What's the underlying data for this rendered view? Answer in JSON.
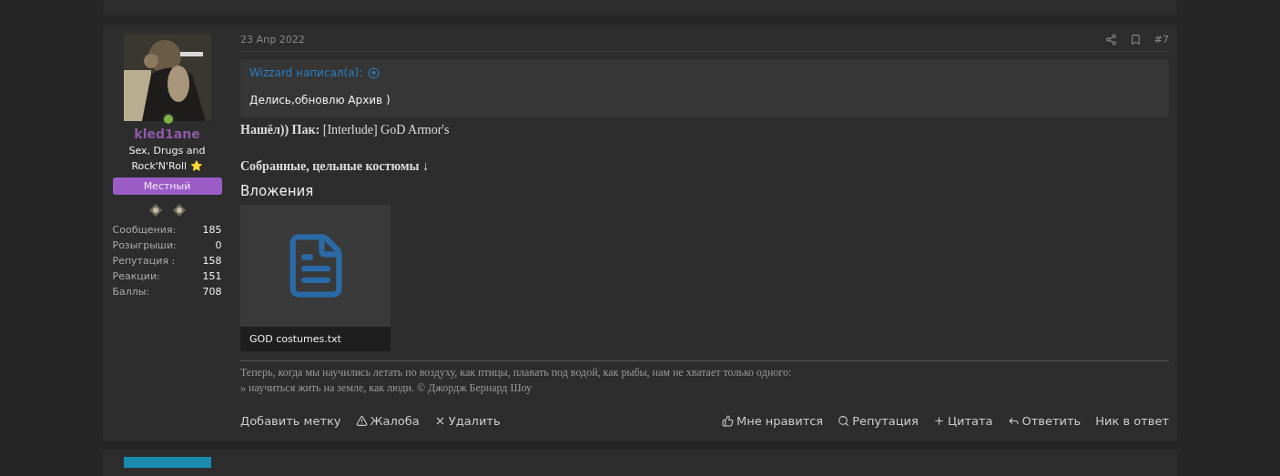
{
  "post": {
    "date": "23 Апр 2022",
    "number": "#7",
    "user": {
      "online": true,
      "name": "kled1ane",
      "title": "Sex, Drugs and Rock'N'Roll ⭐",
      "badge": "Местный",
      "stats": [
        {
          "label": "Сообщения:",
          "value": "185"
        },
        {
          "label": "Розыгрыши:",
          "value": "0"
        },
        {
          "label": "Репутация :",
          "value": "158"
        },
        {
          "label": "Реакции:",
          "value": "151"
        },
        {
          "label": "Баллы:",
          "value": "708"
        }
      ]
    },
    "quote": {
      "author": "Wizzard написал(а):",
      "text": "Делись,обновлю Архив )"
    },
    "body": [
      "**Нашёл)) Пак:** [Interlude] GoD Armor's",
      "**Собранные, цельные костюмы ↓**"
    ],
    "attachments_title": "Вложения",
    "attachments": [
      {
        "name": "GOD costumes.txt"
      }
    ],
    "signature": [
      "Теперь, когда мы научились летать по воздуху, как птицы, плавать под водой, как рыбы, нам не хватает только одного:",
      "» научиться жить на земле, как люди. © Джордж Бернард Шоу"
    ],
    "actions_left": [
      {
        "kind": "plain",
        "label": "Добавить метку"
      },
      {
        "kind": "report",
        "label": "Жалоба"
      },
      {
        "kind": "delete",
        "label": "Удалить"
      }
    ],
    "actions_right": [
      {
        "kind": "like",
        "label": "Мне нравится"
      },
      {
        "kind": "search",
        "label": "Репутация"
      },
      {
        "kind": "plus",
        "label": "Цитата"
      },
      {
        "kind": "reply",
        "label": "Ответить"
      },
      {
        "kind": "plain",
        "label": "Ник в ответ"
      }
    ]
  }
}
